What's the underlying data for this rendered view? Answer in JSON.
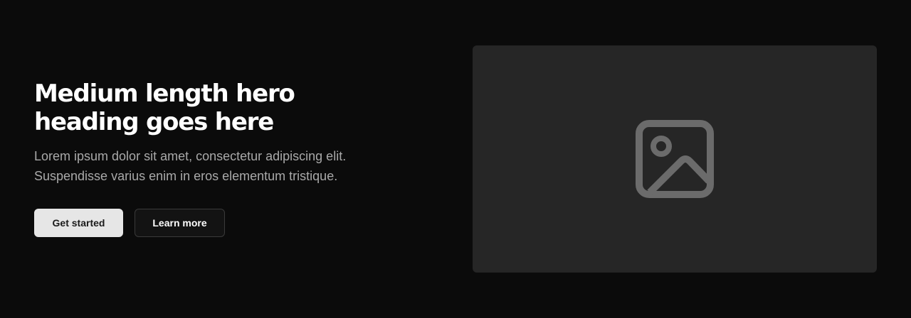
{
  "hero": {
    "heading": "Medium length hero heading goes here",
    "subtext": "Lorem ipsum dolor sit amet, consectetur adipiscing elit. Suspendisse varius enim in eros elementum tristique.",
    "primary_button": "Get started",
    "secondary_button": "Learn more",
    "media_icon": "image-placeholder-icon"
  },
  "colors": {
    "background": "#0b0b0b",
    "heading": "#ffffff",
    "subtext": "#a9a9a9",
    "primary_button_bg": "#e6e6e6",
    "secondary_button_bg": "#131313",
    "media_bg": "#262626",
    "icon": "#6b6b6b"
  }
}
